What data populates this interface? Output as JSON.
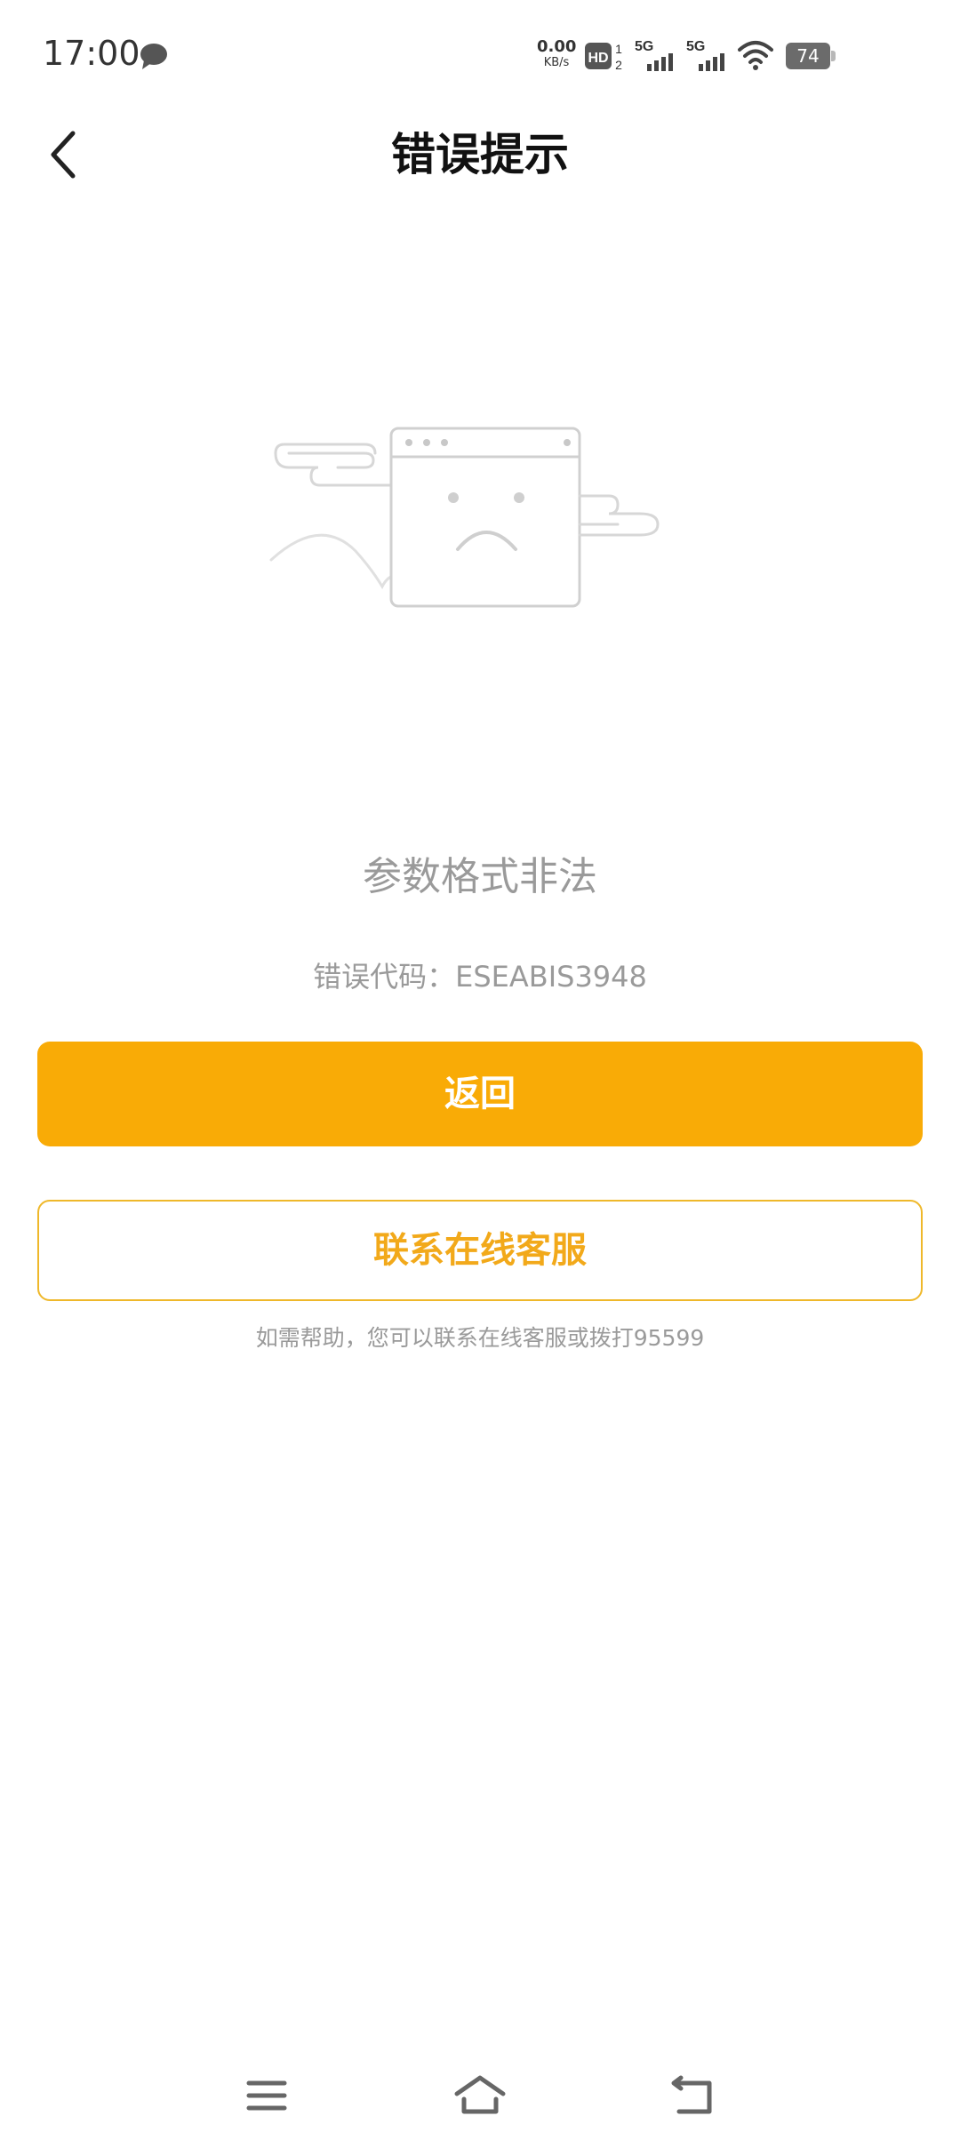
{
  "status_bar": {
    "time": "17:00",
    "net_speed_value": "0.00",
    "net_speed_unit": "KB/s",
    "network_type_1": "5G",
    "network_type_2": "5G",
    "battery_level": "74"
  },
  "nav": {
    "title": "错误提示"
  },
  "content": {
    "error_message": "参数格式非法",
    "error_code": "错误代码：ESEABIS3948",
    "return_button": "返回",
    "contact_button": "联系在线客服",
    "help_text": "如需帮助，您可以联系在线客服或拨打95599"
  },
  "colors": {
    "primary": "#f9ab06",
    "secondary_border": "#efb82a",
    "secondary_text": "#f2a91a",
    "muted_text": "#9a9a9a"
  },
  "icons": {
    "back": "chevron-left-icon",
    "chat": "chat-bubble-icon",
    "wifi": "wifi-icon",
    "menu": "menu-icon",
    "home": "home-icon",
    "system_back": "back-icon"
  }
}
